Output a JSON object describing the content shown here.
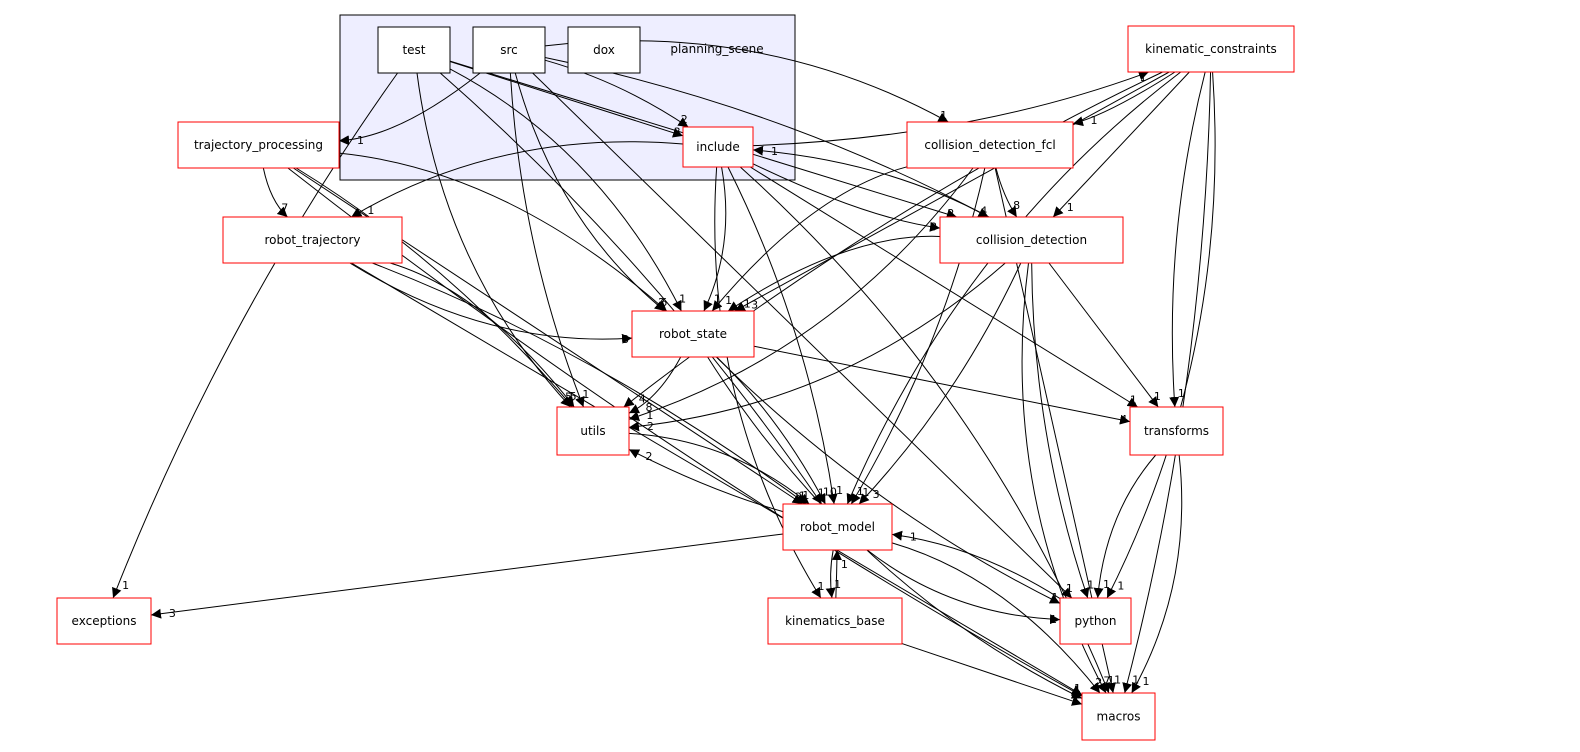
{
  "cluster": {
    "label": "planning_scene",
    "fill": "#eeeeff"
  },
  "colors": {
    "external_border": "#ff0000",
    "internal_border": "#000000",
    "edge": "#000000"
  },
  "nodes": [
    {
      "id": "test",
      "label": "test",
      "inner": true
    },
    {
      "id": "src",
      "label": "src",
      "inner": true
    },
    {
      "id": "dox",
      "label": "dox",
      "inner": true
    },
    {
      "id": "include",
      "label": "include"
    },
    {
      "id": "kinematic_constraints",
      "label": "kinematic_constraints"
    },
    {
      "id": "trajectory_processing",
      "label": "trajectory_processing"
    },
    {
      "id": "collision_detection_fcl",
      "label": "collision_detection_fcl"
    },
    {
      "id": "robot_trajectory",
      "label": "robot_trajectory"
    },
    {
      "id": "collision_detection",
      "label": "collision_detection"
    },
    {
      "id": "robot_state",
      "label": "robot_state"
    },
    {
      "id": "utils",
      "label": "utils"
    },
    {
      "id": "transforms",
      "label": "transforms"
    },
    {
      "id": "robot_model",
      "label": "robot_model"
    },
    {
      "id": "exceptions",
      "label": "exceptions"
    },
    {
      "id": "kinematics_base",
      "label": "kinematics_base"
    },
    {
      "id": "python",
      "label": "python"
    },
    {
      "id": "macros",
      "label": "macros"
    }
  ],
  "edges": [
    {
      "from": "src",
      "to": "trajectory_processing",
      "count": "1"
    },
    {
      "from": "src",
      "to": "include",
      "count": "2"
    },
    {
      "from": "test",
      "to": "include",
      "count": "3"
    },
    {
      "from": "test",
      "to": "exceptions",
      "count": "1"
    },
    {
      "from": "test",
      "to": "utils",
      "count": "5"
    },
    {
      "from": "test",
      "to": "robot_state",
      "count": "1"
    },
    {
      "from": "test",
      "to": "robot_model",
      "count": "1"
    },
    {
      "from": "test",
      "to": "collision_detection",
      "count": "2"
    },
    {
      "from": "src",
      "to": "utils",
      "count": "1"
    },
    {
      "from": "src",
      "to": "robot_state",
      "count": "2"
    },
    {
      "from": "src",
      "to": "collision_detection_fcl",
      "count": "1"
    },
    {
      "from": "src",
      "to": "collision_detection",
      "count": "4"
    },
    {
      "from": "src",
      "to": "python",
      "count": "1"
    },
    {
      "from": "include",
      "to": "kinematic_constraints",
      "count": "1"
    },
    {
      "from": "include",
      "to": "robot_trajectory",
      "count": "1"
    },
    {
      "from": "include",
      "to": "robot_state",
      "count": "1"
    },
    {
      "from": "include",
      "to": "robot_model",
      "count": "1"
    },
    {
      "from": "include",
      "to": "transforms",
      "count": "1"
    },
    {
      "from": "include",
      "to": "collision_detection",
      "count": "3"
    },
    {
      "from": "include",
      "to": "kinematics_base",
      "count": "1"
    },
    {
      "from": "include",
      "to": "macros",
      "count": "1"
    },
    {
      "from": "kinematic_constraints",
      "to": "collision_detection_fcl",
      "count": "1"
    },
    {
      "from": "kinematic_constraints",
      "to": "collision_detection",
      "count": "1"
    },
    {
      "from": "kinematic_constraints",
      "to": "transforms",
      "count": "1"
    },
    {
      "from": "kinematic_constraints",
      "to": "robot_model",
      "count": "1"
    },
    {
      "from": "kinematic_constraints",
      "to": "python",
      "count": "1"
    },
    {
      "from": "kinematic_constraints",
      "to": "macros",
      "count": "1"
    },
    {
      "from": "kinematic_constraints",
      "to": "robot_state",
      "count": "3"
    },
    {
      "from": "kinematic_constraints",
      "to": "utils",
      "count": "4"
    },
    {
      "from": "trajectory_processing",
      "to": "robot_trajectory",
      "count": "7"
    },
    {
      "from": "trajectory_processing",
      "to": "robot_state",
      "count": "6"
    },
    {
      "from": "trajectory_processing",
      "to": "utils",
      "count": "1"
    },
    {
      "from": "trajectory_processing",
      "to": "robot_model",
      "count": "2"
    },
    {
      "from": "trajectory_processing",
      "to": "macros",
      "count": "1"
    },
    {
      "from": "robot_trajectory",
      "to": "robot_state",
      "count": "3"
    },
    {
      "from": "robot_trajectory",
      "to": "utils",
      "count": "5"
    },
    {
      "from": "robot_trajectory",
      "to": "robot_model",
      "count": "1"
    },
    {
      "from": "robot_trajectory",
      "to": "macros",
      "count": "1"
    },
    {
      "from": "collision_detection_fcl",
      "to": "collision_detection",
      "count": "8"
    },
    {
      "from": "collision_detection_fcl",
      "to": "robot_state",
      "count": "1"
    },
    {
      "from": "collision_detection_fcl",
      "to": "utils",
      "count": "1"
    },
    {
      "from": "collision_detection_fcl",
      "to": "robot_model",
      "count": "1"
    },
    {
      "from": "collision_detection_fcl",
      "to": "macros",
      "count": "1"
    },
    {
      "from": "collision_detection",
      "to": "include",
      "count": "1"
    },
    {
      "from": "collision_detection",
      "to": "robot_state",
      "count": "1"
    },
    {
      "from": "collision_detection",
      "to": "utils",
      "count": "2"
    },
    {
      "from": "collision_detection",
      "to": "robot_model",
      "count": "3"
    },
    {
      "from": "collision_detection",
      "to": "transforms",
      "count": "1"
    },
    {
      "from": "collision_detection",
      "to": "python",
      "count": "1"
    },
    {
      "from": "collision_detection",
      "to": "macros",
      "count": "7"
    },
    {
      "from": "robot_state",
      "to": "utils",
      "count": "8"
    },
    {
      "from": "robot_state",
      "to": "robot_model",
      "count": "10"
    },
    {
      "from": "robot_state",
      "to": "transforms",
      "count": "4"
    },
    {
      "from": "robot_state",
      "to": "python",
      "count": "1"
    },
    {
      "from": "robot_state",
      "to": "macros",
      "count": "1"
    },
    {
      "from": "utils",
      "to": "robot_model",
      "count": "1"
    },
    {
      "from": "robot_model",
      "to": "utils",
      "count": "2"
    },
    {
      "from": "robot_model",
      "to": "exceptions",
      "count": "3"
    },
    {
      "from": "robot_model",
      "to": "kinematics_base",
      "count": "1"
    },
    {
      "from": "robot_model",
      "to": "python",
      "count": "1"
    },
    {
      "from": "robot_model",
      "to": "macros",
      "count": "2"
    },
    {
      "from": "kinematics_base",
      "to": "robot_model",
      "count": "1"
    },
    {
      "from": "kinematics_base",
      "to": "macros",
      "count": "1"
    },
    {
      "from": "python",
      "to": "robot_model",
      "count": "1"
    },
    {
      "from": "transforms",
      "to": "python",
      "count": "1"
    },
    {
      "from": "transforms",
      "to": "macros",
      "count": "1"
    }
  ]
}
